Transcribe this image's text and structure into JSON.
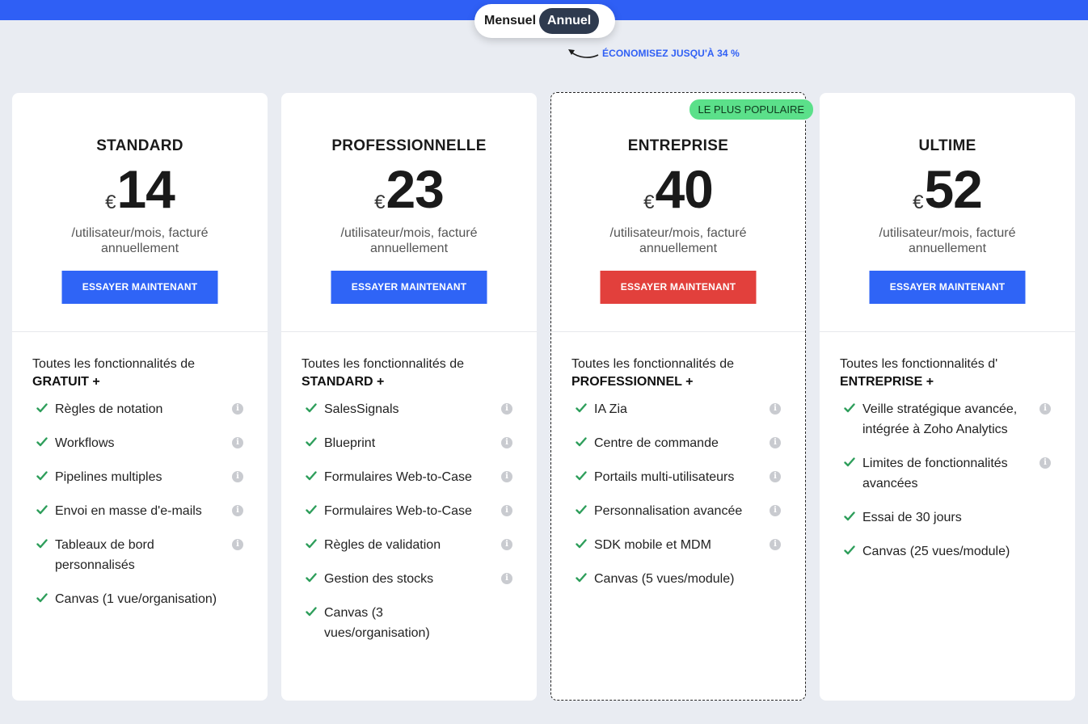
{
  "billing_toggle": {
    "monthly_label": "Mensuel",
    "annual_label": "Annuel",
    "selected": "Annuel"
  },
  "savings_text": "ÉCONOMISEZ JUSQU'À 34 %",
  "colors": {
    "accent_blue": "#2f64f6",
    "cta_red": "#e2403c",
    "badge_green": "#5be08a",
    "check_green": "#2e9e5b"
  },
  "plans": [
    {
      "name": "STANDARD",
      "currency": "€",
      "price": "14",
      "price_note": "/utilisateur/mois, facturé annuellement",
      "cta": "ESSAYER MAINTENANT",
      "intro": "Toutes les fonctionnalités de",
      "intro_strong": "GRATUIT +",
      "features": [
        {
          "label": "Règles de notation",
          "info": true
        },
        {
          "label": "Workflows",
          "info": true
        },
        {
          "label": "Pipelines multiples",
          "info": true
        },
        {
          "label": "Envoi en masse d'e-mails",
          "info": true
        },
        {
          "label": "Tableaux de bord personnalisés",
          "info": true
        },
        {
          "label": "Canvas (1 vue/organisation)",
          "info": false
        }
      ]
    },
    {
      "name": "PROFESSIONNELLE",
      "currency": "€",
      "price": "23",
      "price_note": "/utilisateur/mois, facturé annuellement",
      "cta": "ESSAYER MAINTENANT",
      "intro": "Toutes les fonctionnalités de",
      "intro_strong": "STANDARD +",
      "features": [
        {
          "label": "SalesSignals",
          "info": true
        },
        {
          "label": "Blueprint",
          "info": true
        },
        {
          "label": "Formulaires Web-to-Case",
          "info": true
        },
        {
          "label": "Formulaires Web-to-Case",
          "info": true
        },
        {
          "label": "Règles de validation",
          "info": true
        },
        {
          "label": "Gestion des stocks",
          "info": true
        },
        {
          "label": "Canvas (3 vues/organisation)",
          "info": false
        }
      ]
    },
    {
      "name": "ENTREPRISE",
      "currency": "€",
      "price": "40",
      "price_note": "/utilisateur/mois, facturé annuellement",
      "cta": "ESSAYER MAINTENANT",
      "badge": "LE PLUS POPULAIRE",
      "intro": "Toutes les fonctionnalités de",
      "intro_strong": "PROFESSIONNEL +",
      "features": [
        {
          "label": "IA Zia",
          "info": true
        },
        {
          "label": "Centre de commande",
          "info": true
        },
        {
          "label": "Portails multi-utilisateurs",
          "info": true
        },
        {
          "label": "Personnalisation avancée",
          "info": true
        },
        {
          "label": "SDK mobile et MDM",
          "info": true
        },
        {
          "label": "Canvas (5 vues/module)",
          "info": false
        }
      ]
    },
    {
      "name": "ULTIME",
      "currency": "€",
      "price": "52",
      "price_note": "/utilisateur/mois, facturé annuellement",
      "cta": "ESSAYER MAINTENANT",
      "intro": "Toutes les fonctionnalités d'",
      "intro_strong": "ENTREPRISE +",
      "features": [
        {
          "label": "Veille stratégique avancée, intégrée à Zoho Analytics",
          "info": true
        },
        {
          "label": "Limites de fonctionnalités avancées",
          "info": true
        },
        {
          "label": "Essai de 30 jours",
          "info": false
        },
        {
          "label": "Canvas (25 vues/module)",
          "info": false
        }
      ]
    }
  ]
}
